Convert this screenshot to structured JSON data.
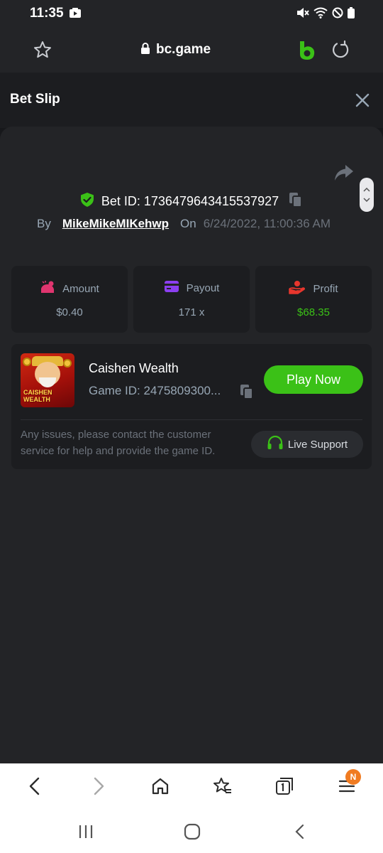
{
  "status_bar": {
    "time": "11:35"
  },
  "browser": {
    "url": "bc.game"
  },
  "sheet": {
    "title": "Bet Slip"
  },
  "bet": {
    "id_label": "Bet ID: 1736479643415537927",
    "by_label": "By",
    "username": "MikeMikeMIKehwp",
    "on_label": "On",
    "date": "6/24/2022, 11:00:36 AM"
  },
  "stats": [
    {
      "label": "Amount",
      "value": "$0.40",
      "icon": "amount-icon",
      "color": "#e0356f"
    },
    {
      "label": "Payout",
      "value": "171 x",
      "icon": "payout-card-icon",
      "color": "#8b3ff0"
    },
    {
      "label": "Profit",
      "value": "$68.35",
      "icon": "profit-hand-icon",
      "color": "#e8362d"
    }
  ],
  "game": {
    "thumbnail_text": "CAISHEN WEALTH",
    "name": "Caishen Wealth",
    "id_text": "Game ID: 2475809300...",
    "play_label": "Play Now",
    "help_text": "Any issues, please contact the customer service for help and provide the game ID.",
    "support_label": "Live Support"
  },
  "nav": {
    "badge": "N"
  },
  "colors": {
    "accent_green": "#3bc117",
    "background": "#232427",
    "card": "#1c1d20",
    "muted": "#98a7b5"
  }
}
